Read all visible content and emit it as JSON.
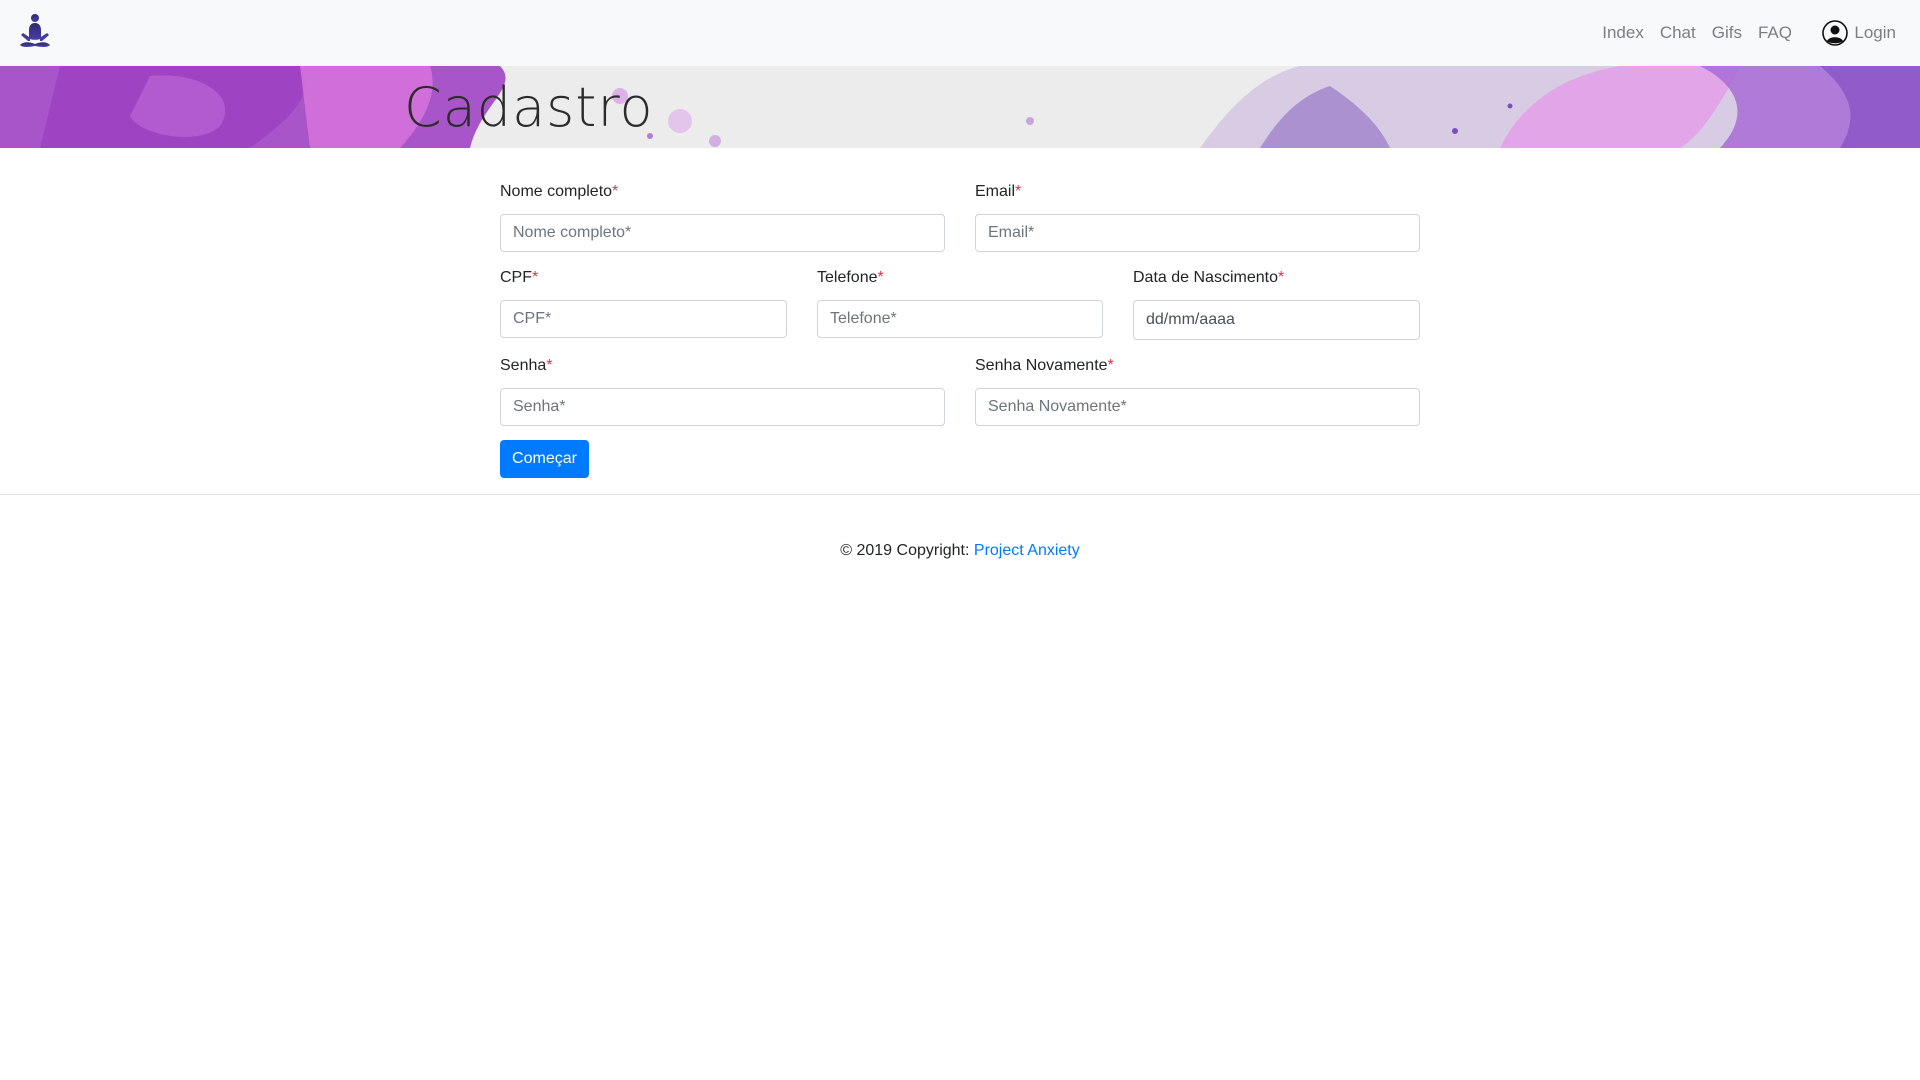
{
  "navbar": {
    "logo_icon": "meditation-figure-icon",
    "links": [
      "Index",
      "Chat",
      "Gifs",
      "FAQ"
    ],
    "login_label": "Login",
    "login_icon": "user-circle-icon"
  },
  "banner": {
    "title": "Cadastro",
    "accent_color": "#b05cd6"
  },
  "form": {
    "full_name": {
      "label": "Nome completo",
      "required_mark": "*",
      "placeholder": "Nome completo*"
    },
    "email": {
      "label": "Email",
      "required_mark": "*",
      "placeholder": "Email*"
    },
    "cpf": {
      "label": "CPF",
      "required_mark": "*",
      "placeholder": "CPF*"
    },
    "phone": {
      "label": "Telefone",
      "required_mark": "*",
      "placeholder": "Telefone*"
    },
    "birth_date": {
      "label": "Data de Nascimento",
      "required_mark": "*",
      "value": "dd/mm/aaaa"
    },
    "password": {
      "label": "Senha",
      "required_mark": "*",
      "placeholder": "Senha*"
    },
    "password_confirm": {
      "label": "Senha Novamente",
      "required_mark": "*",
      "placeholder": "Senha Novamente*"
    },
    "submit_label": "Começar"
  },
  "footer": {
    "copyright_text": "© 2019 Copyright:",
    "link_text": "Project Anxiety"
  },
  "colors": {
    "primary": "#007bff",
    "required": "#dc3545",
    "navbar_bg": "#f8f9fa"
  }
}
